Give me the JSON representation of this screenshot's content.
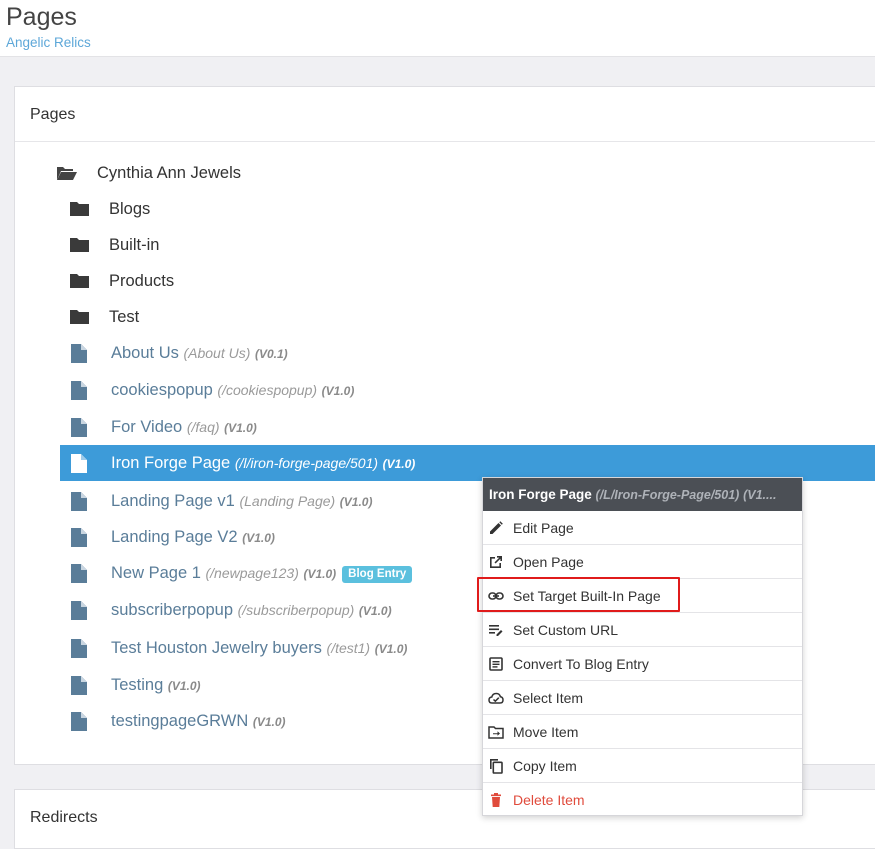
{
  "header": {
    "title": "Pages",
    "subtitle": "Angelic Relics"
  },
  "pages_panel": {
    "title": "Pages",
    "root": {
      "label": "Cynthia Ann Jewels"
    },
    "folders": [
      {
        "label": "Blogs"
      },
      {
        "label": "Built-in"
      },
      {
        "label": "Products"
      },
      {
        "label": "Test"
      }
    ],
    "pages": [
      {
        "title": "About Us",
        "path": "(About Us)",
        "version": "(V0.1)",
        "badge": ""
      },
      {
        "title": "cookiespopup",
        "path": "(/cookiespopup)",
        "version": "(V1.0)",
        "badge": ""
      },
      {
        "title": "For Video",
        "path": "(/faq)",
        "version": "(V1.0)",
        "badge": ""
      },
      {
        "title": "Iron Forge Page",
        "path": "(/l/iron-forge-page/501)",
        "version": "(V1.0)",
        "badge": "",
        "selected": true
      },
      {
        "title": "Landing Page v1",
        "path": "(Landing Page)",
        "version": "(V1.0)",
        "badge": ""
      },
      {
        "title": "Landing Page V2",
        "path": "",
        "version": "(V1.0)",
        "badge": ""
      },
      {
        "title": "New Page 1",
        "path": "(/newpage123)",
        "version": "(V1.0)",
        "badge": "Blog Entry"
      },
      {
        "title": "subscriberpopup",
        "path": "(/subscriberpopup)",
        "version": "(V1.0)",
        "badge": ""
      },
      {
        "title": "Test Houston Jewelry buyers",
        "path": "(/test1)",
        "version": "(V1.0)",
        "badge": ""
      },
      {
        "title": "Testing",
        "path": "",
        "version": "(V1.0)",
        "badge": ""
      },
      {
        "title": "testingpageGRWN",
        "path": "",
        "version": "(V1.0)",
        "badge": ""
      }
    ]
  },
  "redirects_panel": {
    "title": "Redirects"
  },
  "context_menu": {
    "header_title": "Iron Forge Page",
    "header_path": "(/L/Iron-Forge-Page/501)",
    "header_version": "(V1....",
    "items": [
      {
        "label": "Edit Page",
        "icon": "pencil-icon"
      },
      {
        "label": "Open Page",
        "icon": "external-link-icon"
      },
      {
        "label": "Set Target Built-In Page",
        "icon": "link-icon"
      },
      {
        "label": "Set Custom URL",
        "icon": "edit-note-icon"
      },
      {
        "label": "Convert To Blog Entry",
        "icon": "article-icon"
      },
      {
        "label": "Select Item",
        "icon": "cloud-check-icon"
      },
      {
        "label": "Move Item",
        "icon": "move-icon"
      },
      {
        "label": "Copy Item",
        "icon": "copy-icon"
      },
      {
        "label": "Delete Item",
        "icon": "trash-icon"
      }
    ]
  },
  "colors": {
    "accent": "#3d9bd9",
    "page_link": "#5a7d99",
    "danger": "#e04b3c",
    "highlight": "#e01b1b",
    "badge": "#5bc0de"
  }
}
